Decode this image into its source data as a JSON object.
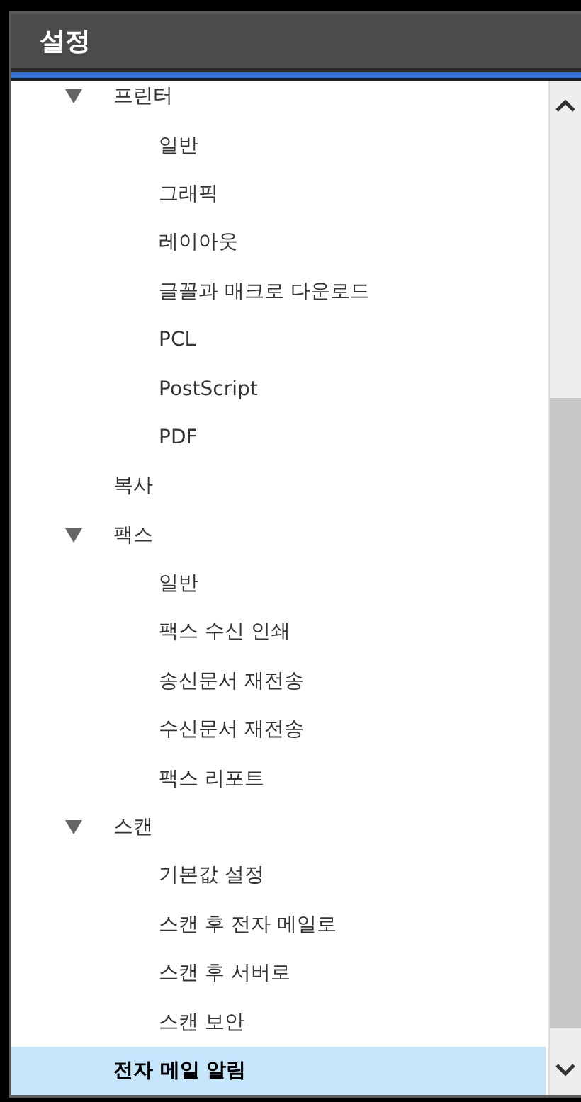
{
  "panel": {
    "title": "설정"
  },
  "tree": [
    {
      "label": "프린터",
      "selected": false,
      "expanded": true,
      "children": [
        {
          "label": "일반",
          "selected": false
        },
        {
          "label": "그래픽",
          "selected": false
        },
        {
          "label": "레이아웃",
          "selected": false
        },
        {
          "label": "글꼴과 매크로 다운로드",
          "selected": false
        },
        {
          "label": "PCL",
          "selected": false
        },
        {
          "label": "PostScript",
          "selected": false
        },
        {
          "label": "PDF",
          "selected": false
        }
      ]
    },
    {
      "label": "복사",
      "selected": false
    },
    {
      "label": "팩스",
      "selected": false,
      "expanded": true,
      "children": [
        {
          "label": "일반",
          "selected": false
        },
        {
          "label": "팩스 수신 인쇄",
          "selected": false
        },
        {
          "label": "송신문서 재전송",
          "selected": false
        },
        {
          "label": "수신문서 재전송",
          "selected": false
        },
        {
          "label": "팩스 리포트",
          "selected": false
        }
      ]
    },
    {
      "label": "스캔",
      "selected": false,
      "expanded": true,
      "children": [
        {
          "label": "기본값 설정",
          "selected": false
        },
        {
          "label": "스캔 후 전자 메일로",
          "selected": false
        },
        {
          "label": "스캔 후 서버로",
          "selected": false
        },
        {
          "label": "스캔 보안",
          "selected": false
        }
      ]
    },
    {
      "label": "전자 메일 알림",
      "selected": true
    }
  ]
}
